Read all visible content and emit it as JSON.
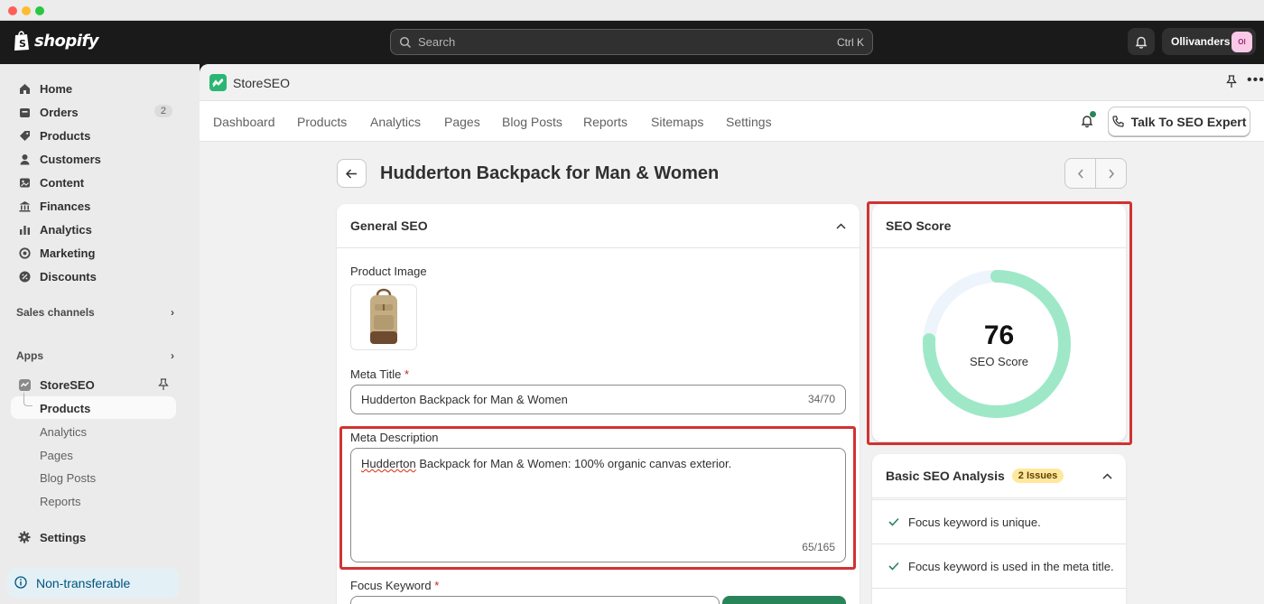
{
  "topbar": {
    "brand": "shopify",
    "search_placeholder": "Search",
    "search_shortcut": "Ctrl K",
    "store_name": "Ollivanders",
    "store_initials": "Ol"
  },
  "sidebar": {
    "items": [
      {
        "label": "Home",
        "icon": "home-icon"
      },
      {
        "label": "Orders",
        "icon": "orders-icon",
        "badge": "2"
      },
      {
        "label": "Products",
        "icon": "tag-icon"
      },
      {
        "label": "Customers",
        "icon": "person-icon"
      },
      {
        "label": "Content",
        "icon": "content-icon"
      },
      {
        "label": "Finances",
        "icon": "bank-icon"
      },
      {
        "label": "Analytics",
        "icon": "bar-chart-icon"
      },
      {
        "label": "Marketing",
        "icon": "target-icon"
      },
      {
        "label": "Discounts",
        "icon": "discount-icon"
      }
    ],
    "sales_channels": "Sales channels",
    "apps": "Apps",
    "app_name": "StoreSEO",
    "app_subitems": [
      "Products",
      "Analytics",
      "Pages",
      "Blog Posts",
      "Reports"
    ],
    "settings": "Settings",
    "non_transferable": "Non-transferable"
  },
  "app": {
    "name": "StoreSEO",
    "tabs": [
      "Dashboard",
      "Products",
      "Analytics",
      "Pages",
      "Blog Posts",
      "Reports",
      "Sitemaps",
      "Settings"
    ],
    "expert_button": "Talk To SEO Expert"
  },
  "page": {
    "title": "Hudderton Backpack for Man & Women"
  },
  "general_seo": {
    "heading": "General SEO",
    "product_image_label": "Product Image",
    "meta_title_label": "Meta Title",
    "meta_title_value": "Hudderton Backpack for Man & Women",
    "meta_title_counter": "34/70",
    "meta_description_label": "Meta Description",
    "meta_description_first_word": "Hudderton",
    "meta_description_rest": " Backpack for Man & Women: 100% organic canvas exterior.",
    "meta_description_counter": "65/165",
    "focus_keyword_label": "Focus Keyword",
    "required_mark": "*"
  },
  "seo_score": {
    "heading": "SEO Score",
    "value": "76",
    "label": "SEO Score",
    "fraction": 0.76
  },
  "basic_analysis": {
    "heading": "Basic SEO Analysis",
    "issues_badge": "2 Issues",
    "checks": [
      "Focus keyword is unique.",
      "Focus keyword is used in the meta title."
    ]
  },
  "colors": {
    "accent_green": "#29845a",
    "score_ring": "#9ee8c8",
    "highlight_red": "#d23232"
  }
}
